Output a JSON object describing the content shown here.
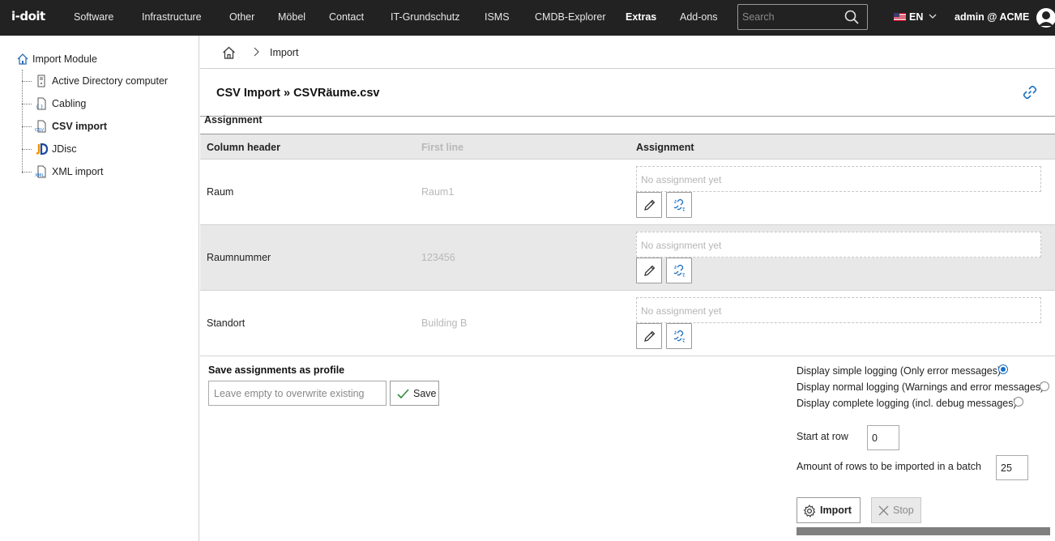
{
  "app": {
    "logo": "i-doit",
    "nav": [
      "Software",
      "Infrastructure",
      "Other",
      "Möbel",
      "Contact",
      "IT-Grundschutz",
      "ISMS",
      "CMDB-Explorer",
      "Extras",
      "Add-ons"
    ],
    "active_nav": "Extras",
    "search_placeholder": "Search",
    "language": "EN",
    "user": "admin @ ACME"
  },
  "sidebar": {
    "root": "Import Module",
    "items": [
      {
        "label": "Active Directory computer",
        "icon": "server-icon"
      },
      {
        "label": "Cabling",
        "icon": "cabling-file-icon"
      },
      {
        "label": "CSV import",
        "icon": "csv-file-icon",
        "active": true
      },
      {
        "label": "JDisc",
        "icon": "jdisc-icon"
      },
      {
        "label": "XML import",
        "icon": "xml-file-icon"
      }
    ]
  },
  "breadcrumb": {
    "current": "Import"
  },
  "page": {
    "title": "CSV Import » CSVRäume.csv",
    "section": "Assignment"
  },
  "table": {
    "headers": {
      "column": "Column header",
      "first_line": "First line",
      "assignment": "Assignment"
    },
    "rows": [
      {
        "column": "Raum",
        "first_line": "Raum1",
        "assignment": "No assignment yet"
      },
      {
        "column": "Raumnummer",
        "first_line": "123456",
        "assignment": "No assignment yet"
      },
      {
        "column": "Standort",
        "first_line": "Building B",
        "assignment": "No assignment yet"
      }
    ]
  },
  "profile": {
    "title": "Save assignments as profile",
    "placeholder": "Leave empty to overwrite existing",
    "save_label": "Save"
  },
  "logging": {
    "options": [
      {
        "label": "Display simple logging (Only error messages)",
        "checked": true
      },
      {
        "label": "Display normal logging (Warnings and error messages)",
        "checked": false
      },
      {
        "label": "Display complete logging (incl. debug messages)",
        "checked": false
      }
    ]
  },
  "settings": {
    "start_row_label": "Start at row",
    "start_row_value": "0",
    "batch_label": "Amount of rows to be imported in a batch",
    "batch_value": "25"
  },
  "actions": {
    "import_label": "Import",
    "stop_label": "Stop"
  },
  "colors": {
    "topbar": "#222222",
    "accent": "#1a6fc4",
    "row_alt": "#e8e8e8"
  }
}
